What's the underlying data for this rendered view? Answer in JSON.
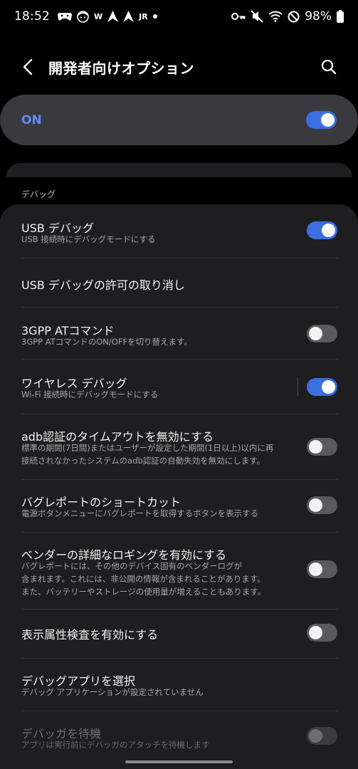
{
  "status_bar": {
    "time": "18:52",
    "notif_icons": [
      "gamepad-icon",
      "face-icon",
      "w-icon",
      "nav-arrow-icon",
      "nav-arrow-icon-2",
      "jr-logo-icon",
      "dot-icon"
    ],
    "w_glyph": "W",
    "jr_glyph": "JR",
    "battery": "98%"
  },
  "header": {
    "title": "開発者向けオプション"
  },
  "master": {
    "label": "ON",
    "enabled": true
  },
  "section": {
    "label": "デバッグ"
  },
  "items": [
    {
      "title": "USB デバッグ",
      "subtitle": "USB 接続時にデバッグモードにする",
      "toggle": "on"
    },
    {
      "title": "USB デバッグの許可の取り消し",
      "subtitle": "",
      "toggle": "none"
    },
    {
      "title": "3GPP ATコマンド",
      "subtitle": "3GPP ATコマンドのON/OFFを切り替えます。",
      "toggle": "off"
    },
    {
      "title": "ワイヤレス デバッグ",
      "subtitle": "Wi-Fi 接続時にデバッグモードにする",
      "toggle": "on"
    },
    {
      "title": "adb認証のタイムアウトを無効にする",
      "subtitle_lines": [
        "標準の期間(7日間)またはユーザーが設定した期間(1日以上)以内に再",
        "接続されなかったシステムのadb認証の自動失効を無効にします。"
      ],
      "toggle": "off"
    },
    {
      "title": "バグレポートのショートカット",
      "subtitle": "電源ボタンメニューにバグレポートを取得するボタンを表示する",
      "toggle": "off"
    },
    {
      "title": "ベンダーの詳細なロギングを有効にする",
      "subtitle_lines": [
        "バグレポートには、その他のデバイス固有のベンダーログが",
        "含まれます。これには、非公開の情報が含まれることがあります。",
        "また、バッテリーやストレージの使用量が増えることもあります。"
      ],
      "toggle": "off"
    },
    {
      "title": "表示属性検査を有効にする",
      "subtitle": "",
      "toggle": "off"
    },
    {
      "title": "デバッグアプリを選択",
      "subtitle": "デバッグ アプリケーションが設定されていません",
      "toggle": "none"
    },
    {
      "title": "デバッガを待機",
      "subtitle": "アプリは実行前にデバッガのアタッチを待機します",
      "toggle": "disabled"
    }
  ],
  "colors": {
    "accent": "#3b6fe0",
    "master_label": "#5f8bf5",
    "card": "#1e1e20",
    "master_card": "#3a3a3e"
  }
}
